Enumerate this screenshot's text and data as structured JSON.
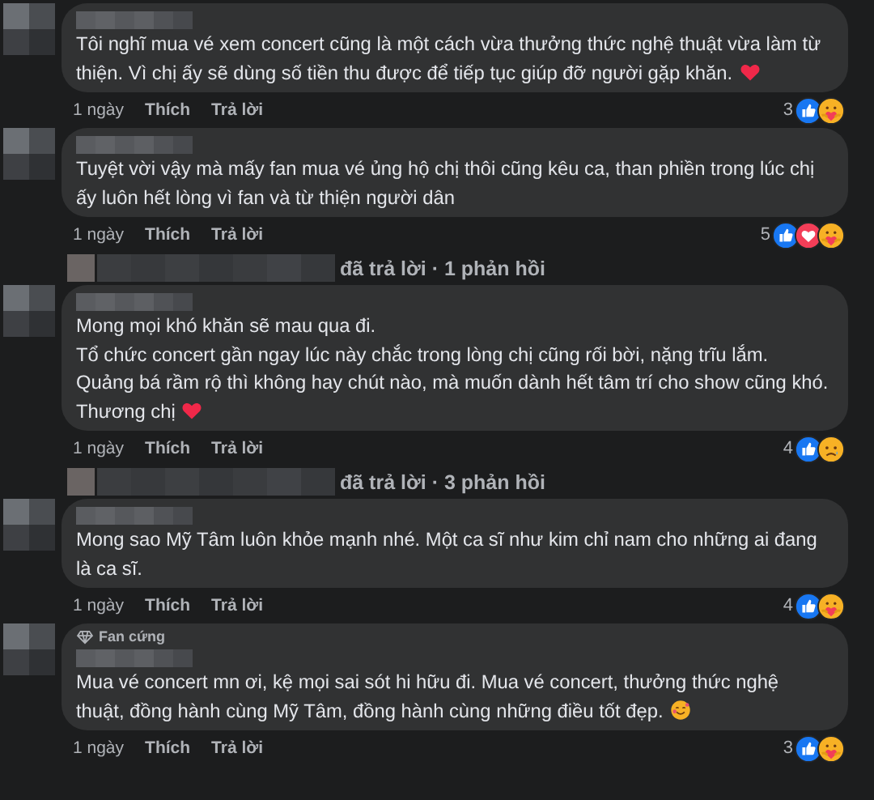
{
  "thread": [
    {
      "kind": "comment",
      "text": "Tôi nghĩ mua vé xem concert cũng là một cách vừa thưởng thức nghệ thuật vừa làm từ thiện. Vì chị ấy sẽ dùng số tiền thu được để tiếp tục giúp đỡ người gặp khăn.",
      "end_icon": {
        "kind": "heart"
      },
      "time": "1 ngày",
      "like": "Thích",
      "reply": "Trả lời",
      "reaction_count": "3",
      "reactions": [
        {
          "kind": "like"
        },
        {
          "kind": "care"
        }
      ]
    },
    {
      "kind": "comment",
      "text": "Tuyệt vời vậy mà mấy fan mua vé ủng hộ chị thôi cũng kêu ca, than phiền trong lúc chị ấy luôn hết lòng vì fan và từ thiện người dân",
      "time": "1 ngày",
      "like": "Thích",
      "reply": "Trả lời",
      "reaction_count": "5",
      "reactions": [
        {
          "kind": "like"
        },
        {
          "kind": "love"
        },
        {
          "kind": "care"
        }
      ]
    },
    {
      "kind": "replies",
      "text": "đã trả lời · 1 phản hồi"
    },
    {
      "kind": "comment",
      "text": "Mong mọi khó khăn sẽ mau qua đi.\nTổ chức concert gần ngay lúc này chắc trong lòng chị cũng rối bời, nặng trĩu lắm.\nQuảng bá rầm rộ thì không hay chút nào, mà muốn dành hết tâm trí cho show cũng khó. Thương chị",
      "end_icon": {
        "kind": "heart"
      },
      "time": "1 ngày",
      "like": "Thích",
      "reply": "Trả lời",
      "reaction_count": "4",
      "reactions": [
        {
          "kind": "like"
        },
        {
          "kind": "sad"
        }
      ]
    },
    {
      "kind": "replies",
      "text": "đã trả lời · 3 phản hồi"
    },
    {
      "kind": "comment",
      "text": "Mong sao Mỹ Tâm luôn khỏe mạnh nhé. Một ca sĩ như kim chỉ nam cho những ai đang là ca sĩ.",
      "time": "1 ngày",
      "like": "Thích",
      "reply": "Trả lời",
      "reaction_count": "4",
      "reactions": [
        {
          "kind": "like"
        },
        {
          "kind": "care"
        }
      ]
    },
    {
      "kind": "comment",
      "badge": "Fan cứng",
      "text": "Mua vé concert mn ơi, kệ mọi sai sót hi hữu đi. Mua vé concert, thưởng thức nghệ thuật, đồng hành cùng Mỹ Tâm, đồng hành cùng những điều tốt đẹp.",
      "end_icon": {
        "kind": "smile-hearts"
      },
      "time": "1 ngày",
      "like": "Thích",
      "reply": "Trả lời",
      "reaction_count": "3",
      "reactions": [
        {
          "kind": "like"
        },
        {
          "kind": "care"
        }
      ]
    }
  ]
}
